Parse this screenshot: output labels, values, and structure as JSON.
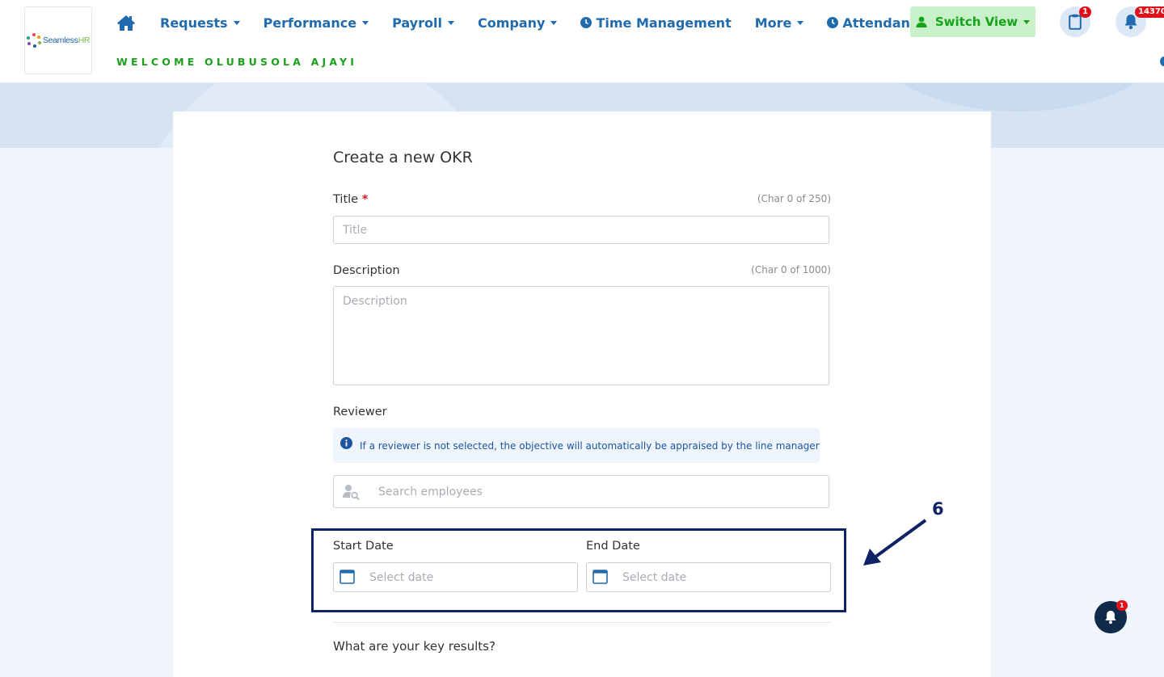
{
  "logo": {
    "text_main": "Seamless",
    "text_accent": "HR"
  },
  "nav": {
    "items": [
      {
        "label": "Requests"
      },
      {
        "label": "Performance"
      },
      {
        "label": "Payroll"
      },
      {
        "label": "Company"
      },
      {
        "label": "Time Management"
      },
      {
        "label": "More"
      },
      {
        "label": "Attendance"
      }
    ],
    "welcome": "WELCOME OLUBUSOLA AJAYI",
    "switch_view": "Switch View",
    "clipboard_badge": "1",
    "notifications_badge": "14370"
  },
  "form": {
    "heading": "Create a new OKR",
    "title_label": "Title",
    "title_required": "*",
    "title_counter": "(Char 0 of 250)",
    "title_placeholder": "Title",
    "description_label": "Description",
    "description_counter": "(Char 0 of 1000)",
    "description_placeholder": "Description",
    "reviewer_label": "Reviewer",
    "reviewer_info": "If a reviewer is not selected, the objective will automatically be appraised by the line manager",
    "reviewer_placeholder": "Search employees",
    "start_date_label": "Start Date",
    "start_date_placeholder": "Select date",
    "end_date_label": "End Date",
    "end_date_placeholder": "Select date",
    "key_results_label": "What are your key results?"
  },
  "annotation": {
    "step": "6"
  },
  "float_bell": {
    "badge": "1"
  },
  "colors": {
    "nav_blue": "#1f6bad",
    "welcome_green": "#1aa01a",
    "switch_bg": "#c8f0c9",
    "annotation_navy": "#0d2366",
    "badge_red": "#e0101a"
  }
}
